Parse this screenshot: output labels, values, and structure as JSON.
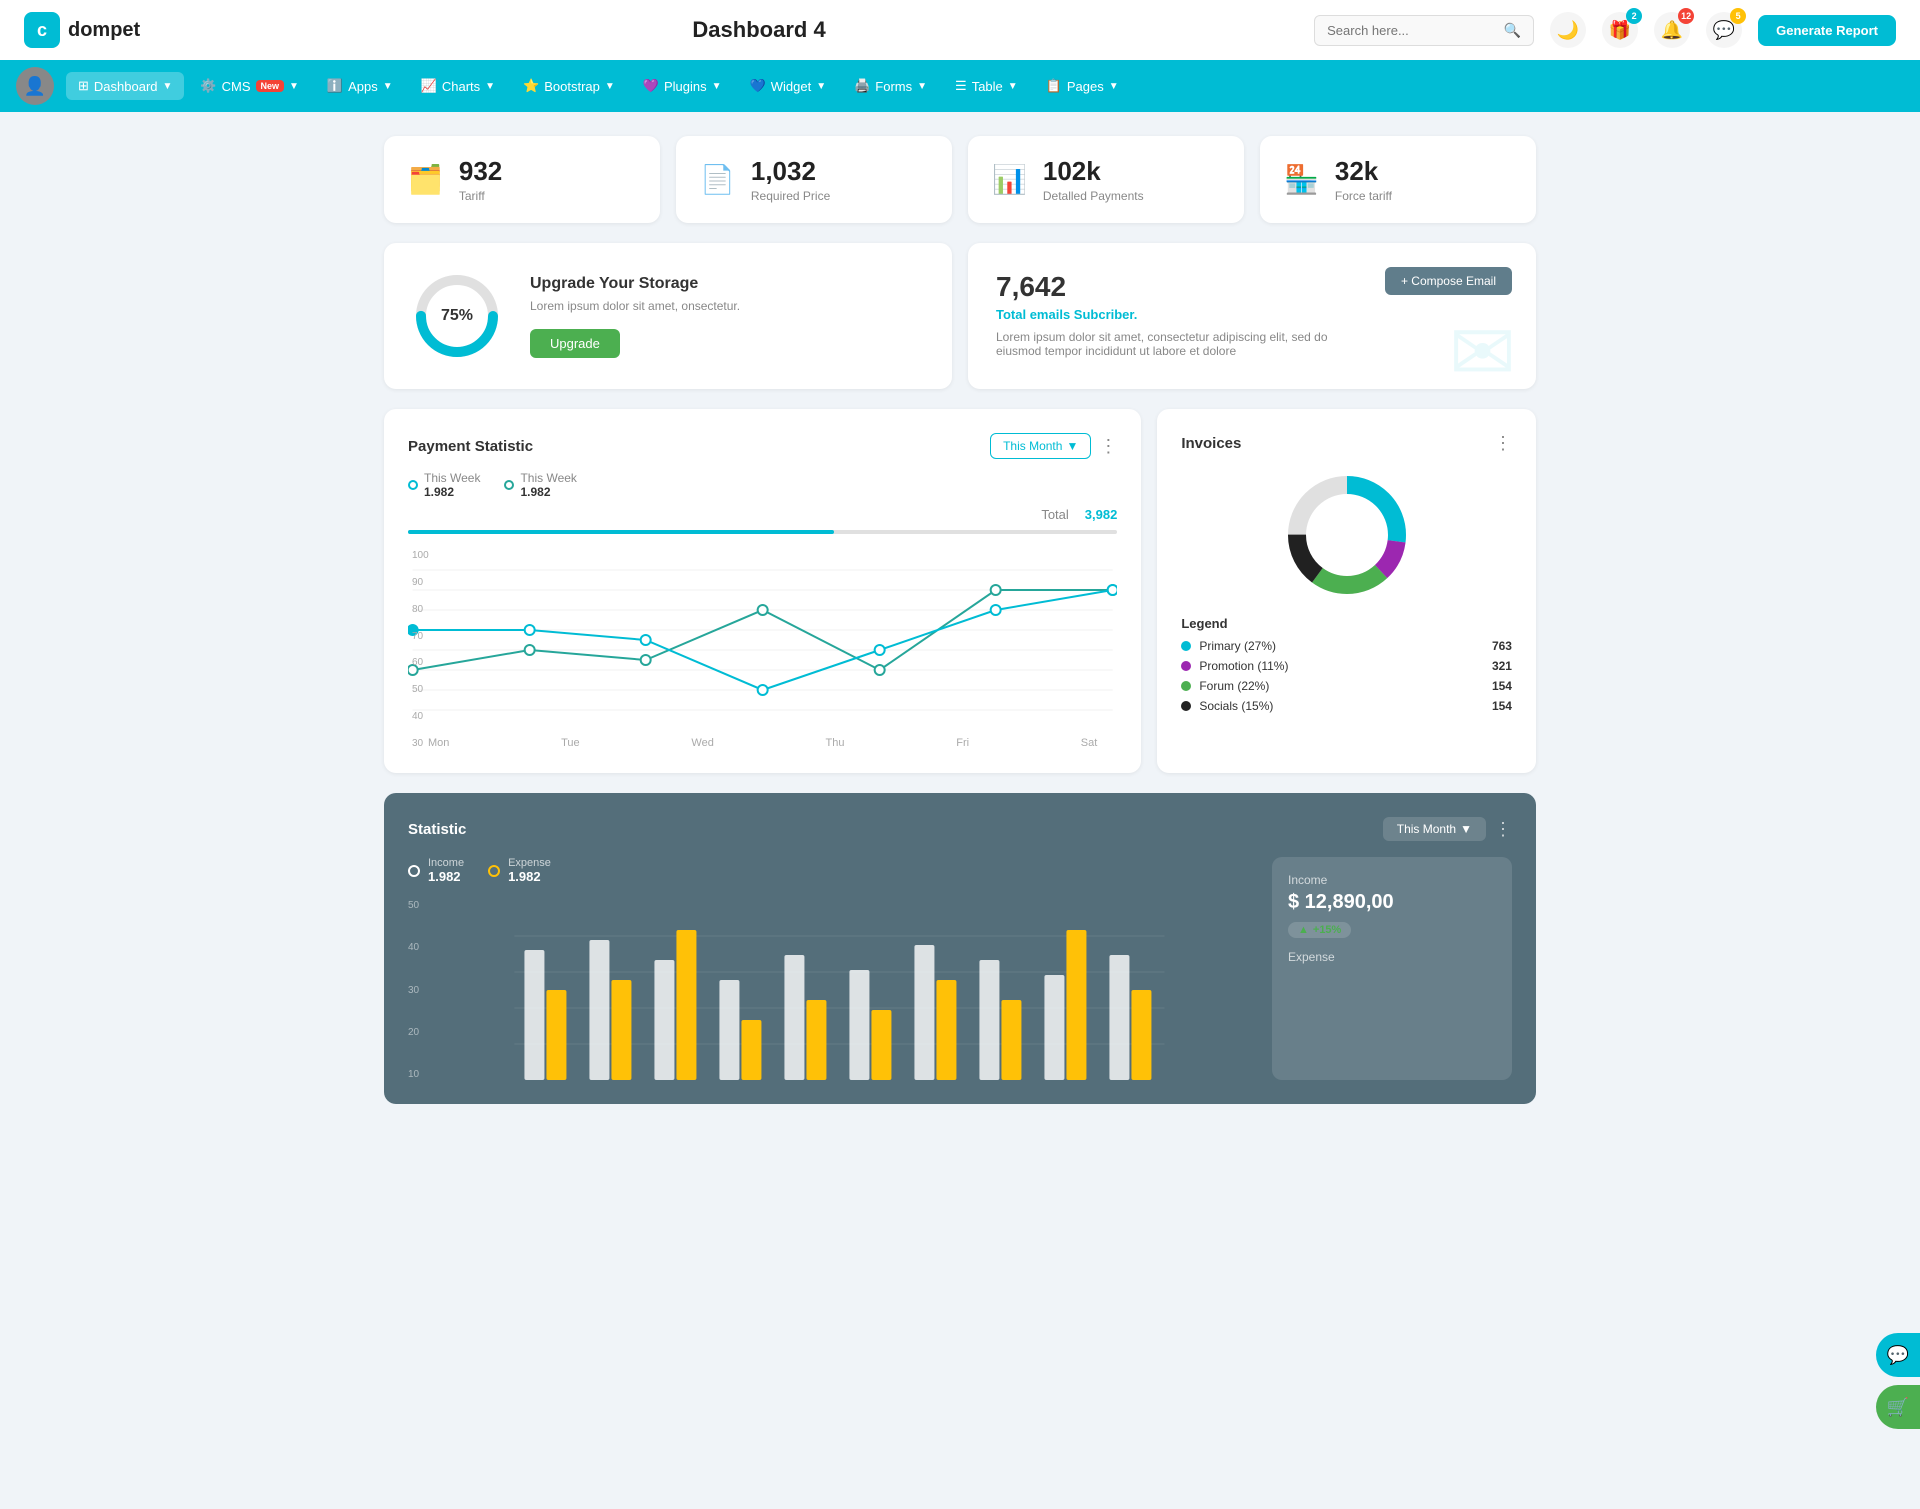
{
  "header": {
    "logo_letter": "c",
    "logo_name": "dompet",
    "page_title": "Dashboard 4",
    "search_placeholder": "Search here...",
    "generate_report": "Generate Report",
    "badges": {
      "gift": "2",
      "bell": "12",
      "chat": "5"
    }
  },
  "nav": {
    "items": [
      {
        "label": "Dashboard",
        "active": true,
        "has_arrow": true
      },
      {
        "label": "CMS",
        "badge": "New",
        "has_arrow": true
      },
      {
        "label": "Apps",
        "has_arrow": true
      },
      {
        "label": "Charts",
        "has_arrow": true
      },
      {
        "label": "Bootstrap",
        "has_arrow": true
      },
      {
        "label": "Plugins",
        "has_arrow": true
      },
      {
        "label": "Widget",
        "has_arrow": true
      },
      {
        "label": "Forms",
        "has_arrow": true
      },
      {
        "label": "Table",
        "has_arrow": true
      },
      {
        "label": "Pages",
        "has_arrow": true
      }
    ]
  },
  "stat_cards": [
    {
      "icon": "🗂️",
      "value": "932",
      "label": "Tariff",
      "color": "#00bcd4"
    },
    {
      "icon": "📄",
      "value": "1,032",
      "label": "Required Price",
      "color": "#f44336"
    },
    {
      "icon": "📊",
      "value": "102k",
      "label": "Detalled Payments",
      "color": "#7c4dff"
    },
    {
      "icon": "🏪",
      "value": "32k",
      "label": "Force tariff",
      "color": "#e91e8c"
    }
  ],
  "storage": {
    "percent": 75,
    "percent_label": "75%",
    "title": "Upgrade Your Storage",
    "description": "Lorem ipsum dolor sit amet, onsectetur.",
    "button_label": "Upgrade"
  },
  "email": {
    "number": "7,642",
    "subtitle": "Total emails Subcriber.",
    "description": "Lorem ipsum dolor sit amet, consectetur adipiscing elit, sed do eiusmod tempor incididunt ut labore et dolore",
    "compose_button": "+ Compose Email"
  },
  "payment": {
    "title": "Payment Statistic",
    "this_month": "This Month",
    "filter_icon": "▼",
    "legend": [
      {
        "label": "This Week",
        "value": "1.982",
        "color_class": "blue"
      },
      {
        "label": "This Week",
        "value": "1.982",
        "color_class": "teal"
      }
    ],
    "total_label": "Total",
    "total_value": "3,982",
    "x_labels": [
      "Mon",
      "Tue",
      "Wed",
      "Thu",
      "Fri",
      "Sat"
    ],
    "y_labels": [
      "100",
      "90",
      "80",
      "70",
      "60",
      "50",
      "40",
      "30"
    ]
  },
  "invoices": {
    "title": "Invoices",
    "legend": [
      {
        "label": "Primary (27%)",
        "color": "#00bcd4",
        "count": "763"
      },
      {
        "label": "Promotion (11%)",
        "color": "#9c27b0",
        "count": "321"
      },
      {
        "label": "Forum (22%)",
        "color": "#4caf50",
        "count": "154"
      },
      {
        "label": "Socials (15%)",
        "color": "#212121",
        "count": "154"
      }
    ]
  },
  "statistic": {
    "title": "Statistic",
    "this_month": "This Month",
    "income_label": "Income",
    "income_value": "1.982",
    "expense_label": "Expense",
    "expense_value": "1.982",
    "income_panel_label": "Income",
    "income_panel_value": "$ 12,890,00",
    "income_badge": "+15%",
    "y_labels": [
      "50",
      "40",
      "30",
      "20",
      "10"
    ],
    "month_filter": "Month"
  },
  "colors": {
    "primary": "#00bcd4",
    "secondary": "#26a69a",
    "purple": "#9c27b0",
    "green": "#4caf50",
    "yellow": "#ffc107",
    "nav_bg": "#00bcd4"
  }
}
